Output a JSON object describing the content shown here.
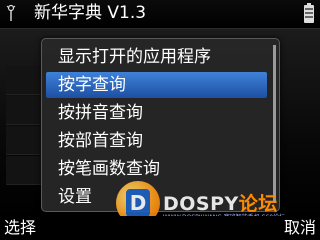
{
  "header": {
    "app_title": "新华字典 V1.3",
    "signal_icon": "signal-antenna-icon",
    "battery_icon": "battery-icon"
  },
  "menu": {
    "items": [
      {
        "label": "显示打开的应用程序",
        "selected": false
      },
      {
        "label": "按字查询",
        "selected": true
      },
      {
        "label": "按拼音查询",
        "selected": false
      },
      {
        "label": "按部首查询",
        "selected": false
      },
      {
        "label": "按笔画数查询",
        "selected": false
      },
      {
        "label": "设置",
        "selected": false
      }
    ]
  },
  "softkeys": {
    "left": "选择",
    "right": "取消"
  },
  "watermark": {
    "logo_letter": "D",
    "text_main": "DOSPY",
    "text_accent": "论坛",
    "sub": "WWW.DOSPY.WANG  塞班智能手机  S60论坛"
  },
  "colors": {
    "selection": "#2f6cc4",
    "menu_bg": "#262626",
    "watermark_accent": "#ff8a00"
  }
}
